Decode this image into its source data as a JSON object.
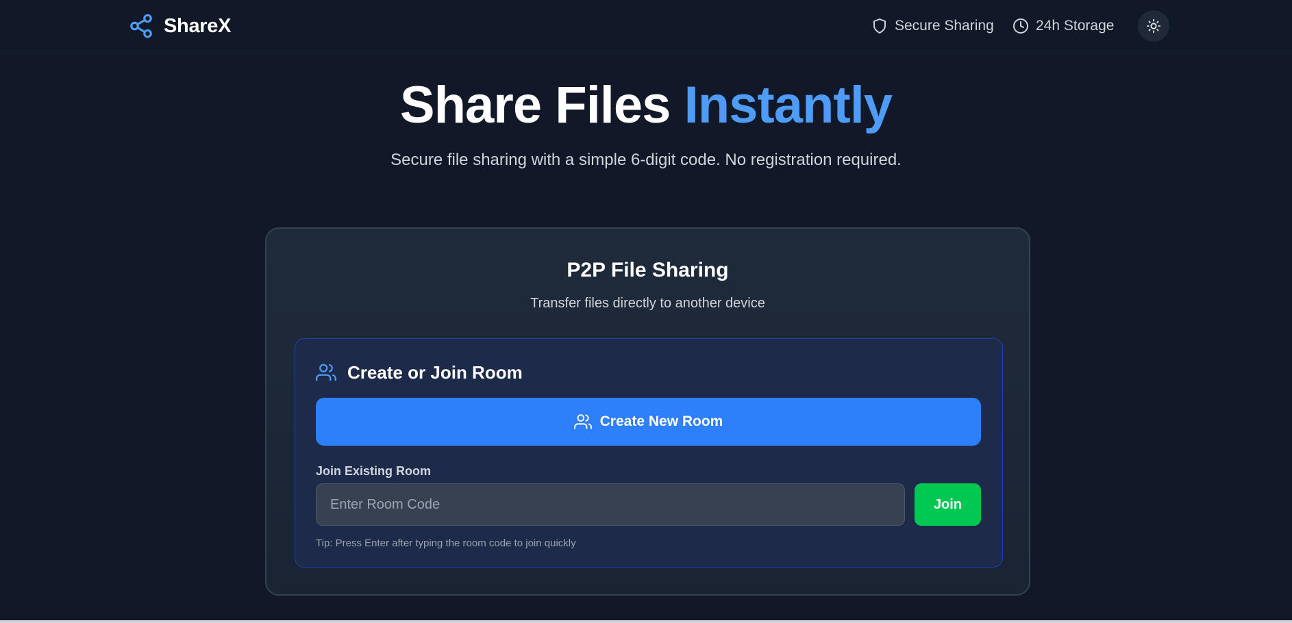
{
  "header": {
    "brand_name": "ShareX",
    "features": [
      {
        "label": "Secure Sharing",
        "icon": "shield-icon"
      },
      {
        "label": "24h Storage",
        "icon": "clock-icon"
      }
    ],
    "theme_toggle_icon": "sun-icon"
  },
  "hero": {
    "title_main": "Share Files",
    "title_accent": "Instantly",
    "subtitle": "Secure file sharing with a simple 6-digit code. No registration required."
  },
  "card": {
    "title": "P2P File Sharing",
    "subtitle": "Transfer files directly to another device",
    "room_panel": {
      "title": "Create or Join Room",
      "title_icon": "users-icon",
      "create_button_label": "Create New Room",
      "join_label": "Join Existing Room",
      "room_code_placeholder": "Enter Room Code",
      "room_code_value": "",
      "join_button_label": "Join",
      "tip": "Tip: Press Enter after typing the room code to join quickly"
    }
  },
  "colors": {
    "background": "#111827",
    "accent_blue": "#4f9cf7",
    "primary_button": "#2d7ffa",
    "join_button": "#00c853",
    "panel_border": "#1e40af"
  }
}
